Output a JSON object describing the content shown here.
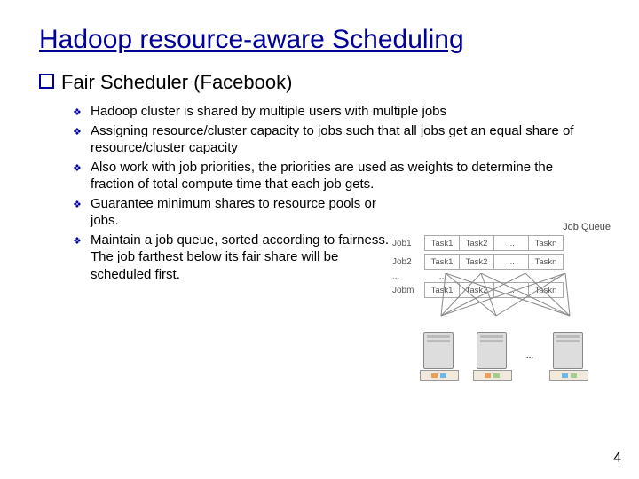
{
  "title": "Hadoop resource-aware Scheduling",
  "sub": "Fair Scheduler (Facebook)",
  "items": [
    "Hadoop cluster is shared by multiple users with multiple jobs",
    "Assigning resource/cluster capacity to jobs such that all jobs get an equal share of resource/cluster capacity",
    "Also work with job priorities, the priorities are used as weights to determine the fraction of total compute time that each job gets.",
    "Guarantee minimum shares to resource pools or jobs.",
    "Maintain a job queue, sorted according to fairness. The job farthest below its fair share will be scheduled first."
  ],
  "diagram": {
    "queue_label": "Job Queue",
    "jobs": [
      "Job1",
      "Job2",
      "Jobm"
    ],
    "tasks": [
      "Task1",
      "Task2",
      "...",
      "Taskn"
    ],
    "dots": "...",
    "server_dots": "..."
  },
  "page": "4"
}
